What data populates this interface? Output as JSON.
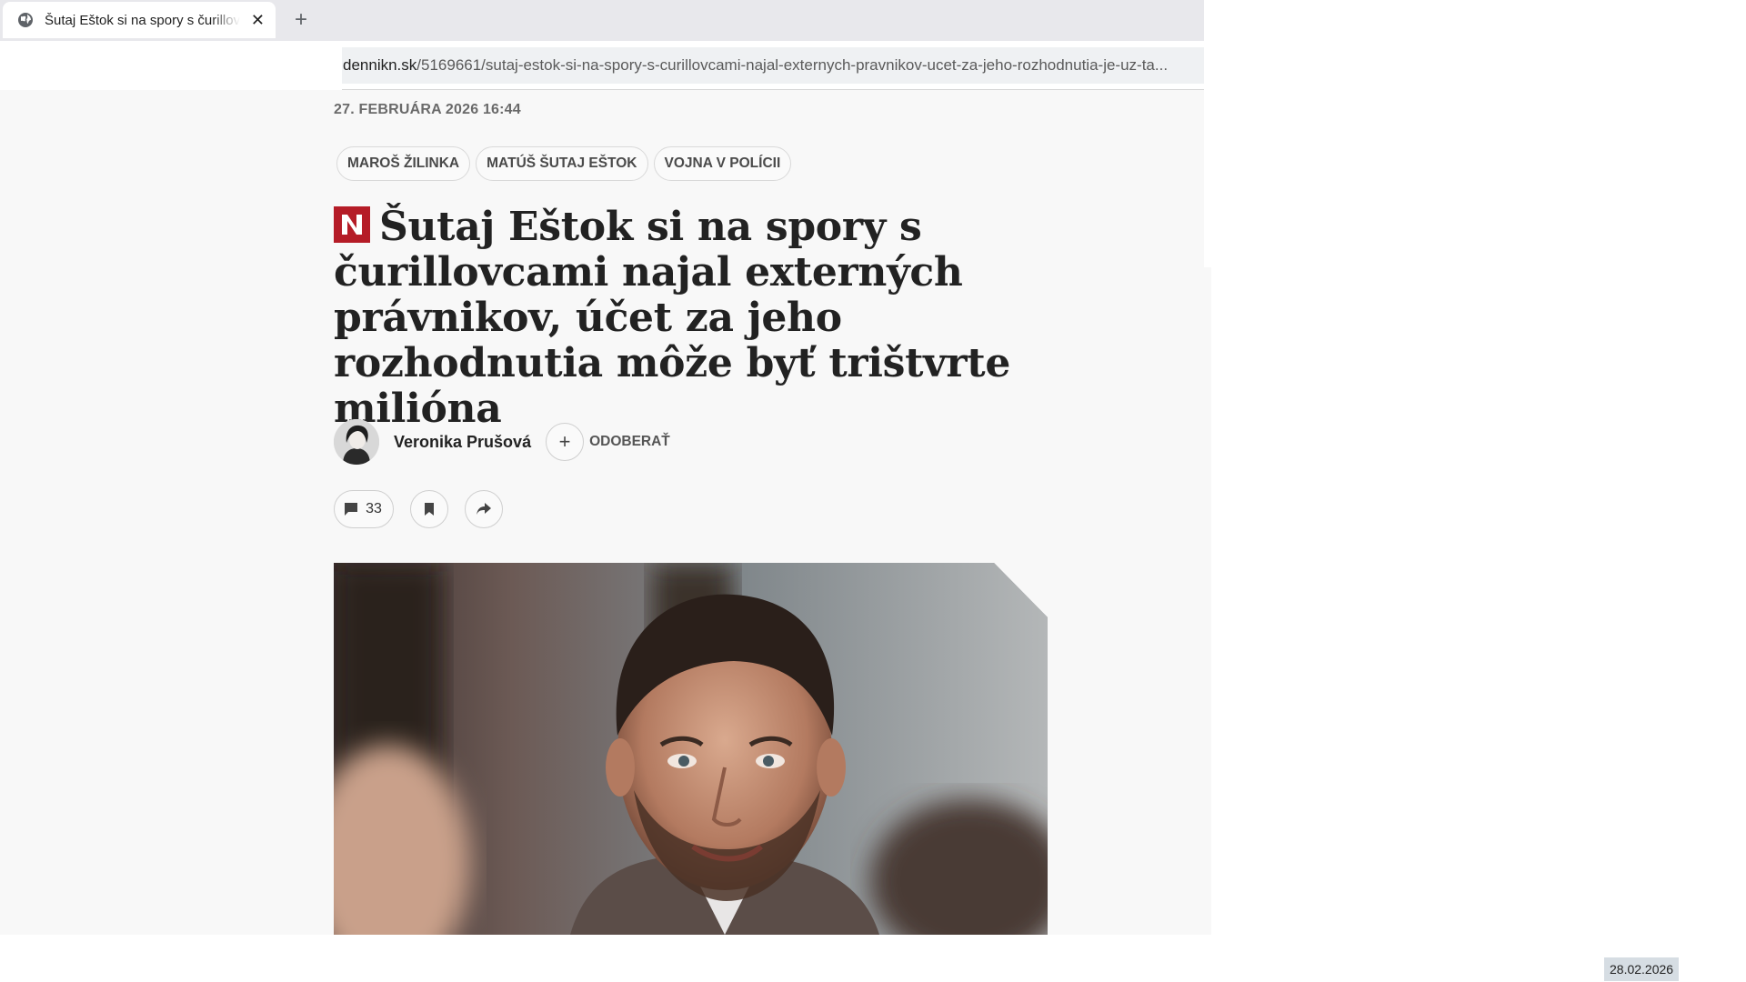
{
  "browser": {
    "tab_title": "Šutaj Eštok si na spory s čurillovcami najal externých právnikov",
    "close_symbol": "✕",
    "new_tab_symbol": "+",
    "url_host": "dennikn.sk",
    "url_path": "/5169661/sutaj-estok-si-na-spory-s-curillovcami-najal-externych-pravnikov-ucet-za-jeho-rozhodnutia-je-uz-ta..."
  },
  "article": {
    "date": "27. FEBRUÁRA 2026 16:44",
    "tags": [
      "MAROŠ ŽILINKA",
      "MATÚŠ ŠUTAJ EŠTOK",
      "VOJNA V POLÍCII"
    ],
    "headline": "Šutaj Eštok si na spory s čurillovcami najal externých právnikov, účet za jeho rozhodnutia môže byť trištvrte milióna",
    "brand_color": "#b51c27",
    "author": {
      "name": "Veronika Prušová",
      "follow_symbol": "+",
      "follow_label": "ODOBERAŤ"
    },
    "actions": {
      "comment_count": "33",
      "icons": [
        "comment-icon",
        "bookmark-icon",
        "share-icon"
      ]
    }
  },
  "overlay": {
    "date_badge": "28.02.2026"
  }
}
